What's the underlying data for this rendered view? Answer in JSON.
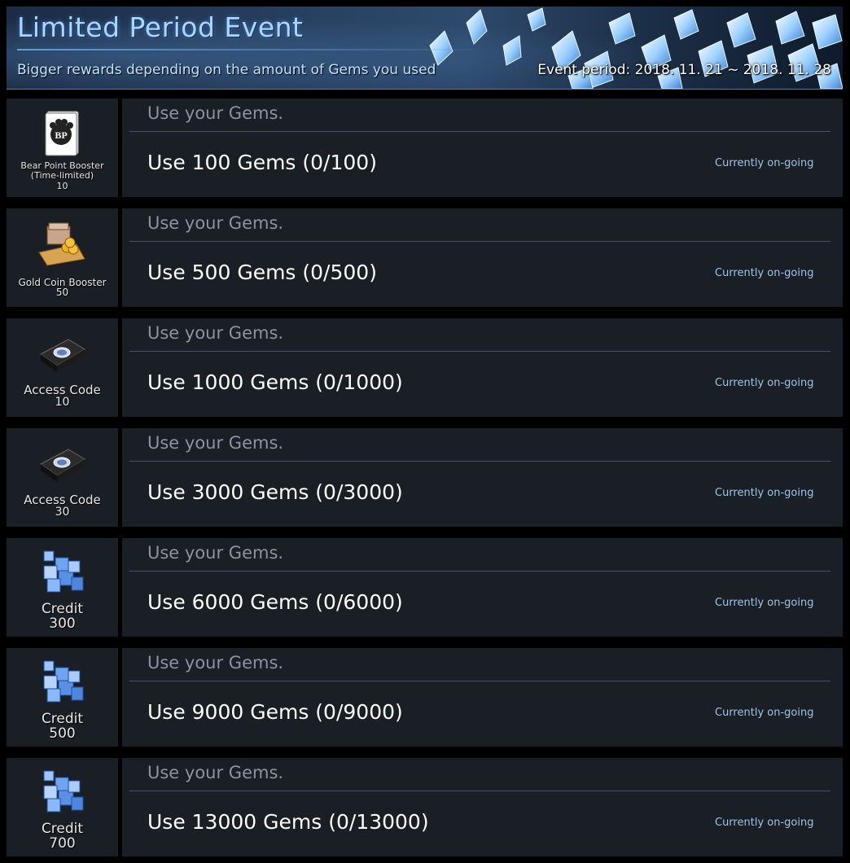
{
  "banner": {
    "title": "Limited Period Event",
    "subtitle": "Bigger rewards depending on the amount of Gems you used",
    "period": "Event period: 2018. 11. 21 ~ 2018. 11. 28"
  },
  "missions": [
    {
      "header": "Use your Gems.",
      "goal": "Use 100 Gems (0/100)",
      "status": "Currently on-going",
      "reward": {
        "icon": "bear-point-booster-icon",
        "name": "Bear Point Booster",
        "name2": "(Time-limited)",
        "qty": "10",
        "icon_label": "BP"
      }
    },
    {
      "header": "Use your Gems.",
      "goal": "Use 500 Gems (0/500)",
      "status": "Currently on-going",
      "reward": {
        "icon": "gold-coin-booster-icon",
        "name": "Gold Coin Booster",
        "qty": "50"
      }
    },
    {
      "header": "Use your Gems.",
      "goal": "Use 1000 Gems (0/1000)",
      "status": "Currently on-going",
      "reward": {
        "icon": "access-code-icon",
        "name": "Access Code",
        "qty": "10"
      }
    },
    {
      "header": "Use your Gems.",
      "goal": "Use 3000 Gems (0/3000)",
      "status": "Currently on-going",
      "reward": {
        "icon": "access-code-icon",
        "name": "Access Code",
        "qty": "30"
      }
    },
    {
      "header": "Use your Gems.",
      "goal": "Use 6000 Gems (0/6000)",
      "status": "Currently on-going",
      "reward": {
        "icon": "credit-icon",
        "name": "Credit",
        "qty": "300"
      }
    },
    {
      "header": "Use your Gems.",
      "goal": "Use 9000 Gems (0/9000)",
      "status": "Currently on-going",
      "reward": {
        "icon": "credit-icon",
        "name": "Credit",
        "qty": "500"
      }
    },
    {
      "header": "Use your Gems.",
      "goal": "Use 13000 Gems (0/13000)",
      "status": "Currently on-going",
      "reward": {
        "icon": "credit-icon",
        "name": "Credit",
        "qty": "700"
      }
    }
  ],
  "colors": {
    "background": "#000000",
    "panel": "#1a1e25",
    "title": "#a9d7ff",
    "status": "#9fc4e8"
  }
}
